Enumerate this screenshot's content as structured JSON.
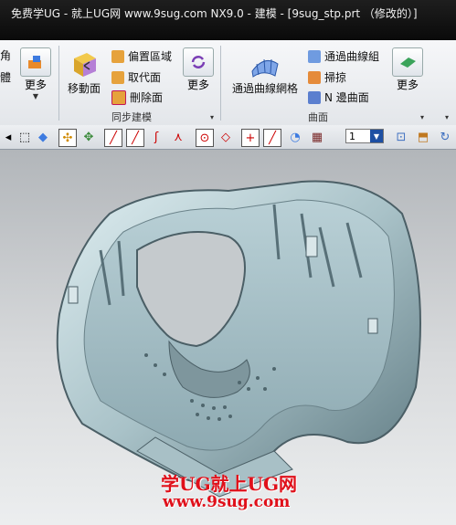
{
  "window": {
    "title": "免费学UG - 就上UG网 www.9sug.com NX9.0 - 建模 - [9sug_stp.prt （修改的）]"
  },
  "ribbon": {
    "left_partial": {
      "top": "角",
      "bottom": "體"
    },
    "more_label": "更多",
    "sync_group": {
      "label": "同步建模",
      "move_face": "移動面",
      "offset_region": "偏置區域",
      "replace_face": "取代面",
      "delete_face": "刪除面"
    },
    "surface_group": {
      "label": "曲面",
      "through_curve_mesh": "通過曲線網格",
      "through_curves": "通過曲線組",
      "sweep": "掃掠",
      "n_sided_surface": "N 邊曲面"
    }
  },
  "toolbar": {
    "zoom_value": "1"
  },
  "watermark": {
    "line1": "学UG就上UG网",
    "line2": "www.9sug.com"
  },
  "colors": {
    "part": "#b9d0d6",
    "title_bg": "#111111",
    "watermark": "#e0101a"
  }
}
